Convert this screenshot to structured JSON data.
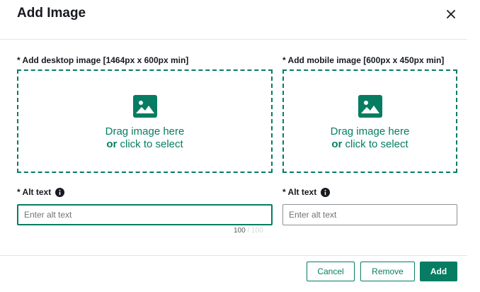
{
  "modal": {
    "title": "Add Image",
    "close_icon": "close-icon"
  },
  "desktop": {
    "label": "* Add desktop image [1464px x 600px min]",
    "drop_line1": "Drag image here",
    "drop_or": "or",
    "drop_line2_rest": " click to select",
    "icon": "image-icon"
  },
  "mobile": {
    "label": "* Add mobile image [600px x 450px min]",
    "drop_line1": "Drag image here",
    "drop_or": "or",
    "drop_line2_rest": " click to select",
    "icon": "image-icon"
  },
  "alt_desktop": {
    "label": "* Alt text",
    "placeholder": "Enter alt text",
    "value": "",
    "counter_current": "100",
    "counter_sep": " / ",
    "counter_max": "100",
    "info_icon": "info-icon"
  },
  "alt_mobile": {
    "label": "* Alt text",
    "placeholder": "Enter alt text",
    "value": "",
    "info_icon": "info-icon"
  },
  "footer": {
    "cancel_label": "Cancel",
    "remove_label": "Remove",
    "add_label": "Add"
  },
  "colors": {
    "accent": "#067d62",
    "text": "#16191f",
    "divider": "#e3e6e6",
    "placeholder": "#6f7373"
  }
}
